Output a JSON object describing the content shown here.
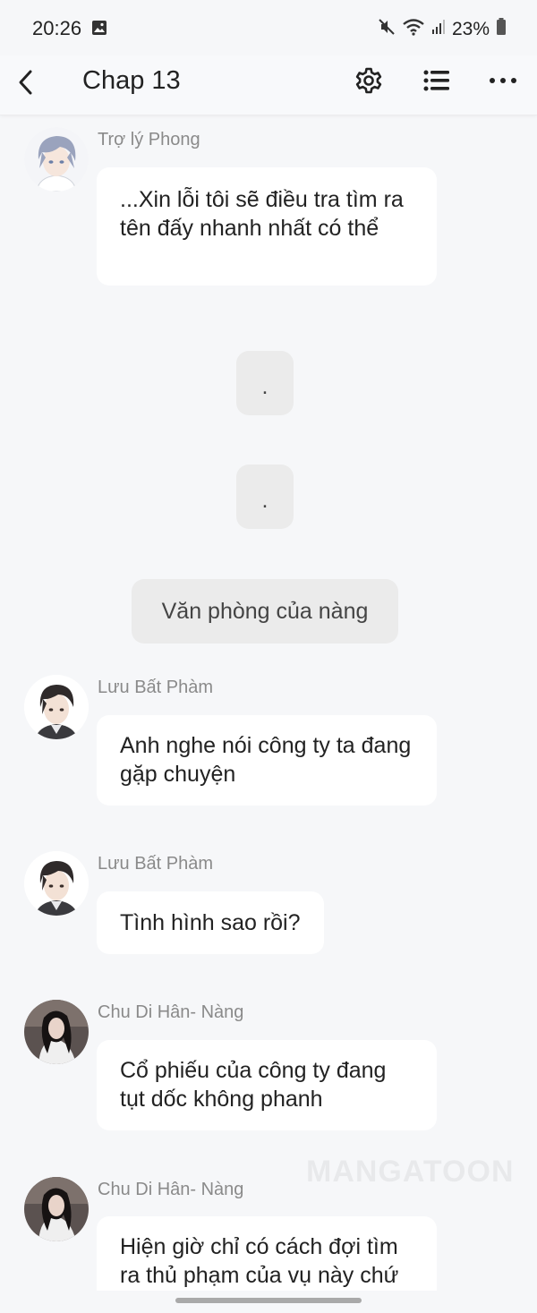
{
  "status_bar": {
    "time": "20:26",
    "battery": "23%",
    "icons": [
      "gallery-icon",
      "mute-icon",
      "wifi-icon",
      "signal-icon",
      "battery-icon"
    ]
  },
  "header": {
    "title": "Chap 13",
    "icons": [
      "back-arrow-icon",
      "gear-icon",
      "list-icon",
      "more-dots-icon"
    ]
  },
  "messages": [
    {
      "sender": "Trợ lý Phong",
      "text": "...Xin lỗi tôi sẽ điều tra tìm ra tên đấy nhanh nhất có thể"
    },
    {
      "sender": "Lưu Bất Phàm",
      "text": "Anh nghe nói công ty ta đang gặp chuyện"
    },
    {
      "sender": "Lưu Bất Phàm",
      "text": "Tình hình sao rồi?"
    },
    {
      "sender": "Chu Di Hân- Nàng",
      "text": "Cổ phiếu của công ty đang tụt dốc không phanh"
    },
    {
      "sender": "Chu Di Hân- Nàng",
      "text": "Hiện giờ chỉ có cách đợi tìm ra thủ phạm của vụ này chứ"
    }
  ],
  "narration": [
    {
      "text": "."
    },
    {
      "text": "."
    },
    {
      "text": "Văn phòng của nàng"
    }
  ],
  "watermark": "MANGATOON",
  "colors": {
    "background": "#f6f7f9",
    "bubble": "#ffffff",
    "narration_bubble": "#ebebeb",
    "sender_name": "#8a8a8a"
  }
}
